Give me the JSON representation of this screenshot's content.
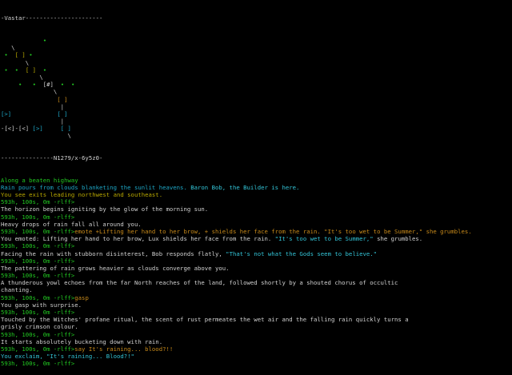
{
  "header": {
    "title_line": "-Vastar----------------------"
  },
  "colors": {
    "prompt": "#22c822",
    "map_node": "#22c822",
    "map_room": "#b9a800",
    "exit": "#1ea8c8",
    "speech": "#33c5d8",
    "emote": "#c88a1a"
  },
  "map": {
    "rows": [
      [
        {
          "t": "            ",
          "c": "c-white"
        },
        {
          "t": "•",
          "c": "c-green"
        }
      ],
      [
        {
          "t": "   \\",
          "c": "c-white"
        }
      ],
      [
        {
          "t": " ",
          "c": "c-white"
        },
        {
          "t": "•",
          "c": "c-green"
        },
        {
          "t": "  ",
          "c": "c-white"
        },
        {
          "t": "[ ]",
          "c": "c-olive"
        },
        {
          "t": " ",
          "c": "c-white"
        },
        {
          "t": "•",
          "c": "c-green"
        }
      ],
      [
        {
          "t": "       \\",
          "c": "c-white"
        }
      ],
      [
        {
          "t": " ",
          "c": "c-white"
        },
        {
          "t": "•",
          "c": "c-green"
        },
        {
          "t": "  ",
          "c": "c-white"
        },
        {
          "t": "•",
          "c": "c-green"
        },
        {
          "t": "  ",
          "c": "c-white"
        },
        {
          "t": "[ ]",
          "c": "c-olive"
        },
        {
          "t": "  ",
          "c": "c-white"
        },
        {
          "t": "•",
          "c": "c-green"
        }
      ],
      [
        {
          "t": "           \\",
          "c": "c-white"
        }
      ],
      [
        {
          "t": "     ",
          "c": "c-white"
        },
        {
          "t": "•",
          "c": "c-green"
        },
        {
          "t": "   ",
          "c": "c-white"
        },
        {
          "t": "•",
          "c": "c-green"
        },
        {
          "t": "  ",
          "c": "c-white"
        },
        {
          "t": "[#]",
          "c": "c-white"
        },
        {
          "t": "  ",
          "c": "c-white"
        },
        {
          "t": "•",
          "c": "c-green"
        },
        {
          "t": "  ",
          "c": "c-white"
        },
        {
          "t": "•",
          "c": "c-green"
        }
      ],
      [
        {
          "t": "               \\",
          "c": "c-white"
        }
      ],
      [
        {
          "t": "                ",
          "c": "c-white"
        },
        {
          "t": "[ ]",
          "c": "c-orange"
        }
      ],
      [
        {
          "t": "                 |",
          "c": "c-white"
        }
      ],
      [
        {
          "t": "[>]",
          "c": "c-cyan"
        },
        {
          "t": "             ",
          "c": "c-white"
        },
        {
          "t": "[ ]",
          "c": "c-cyan"
        }
      ],
      [
        {
          "t": "                 |",
          "c": "c-white"
        }
      ],
      [
        {
          "t": "-[<]-[<] ",
          "c": "c-white"
        },
        {
          "t": "[>]",
          "c": "c-cyan"
        },
        {
          "t": "     ",
          "c": "c-white"
        },
        {
          "t": "[ ]",
          "c": "c-cyan"
        }
      ],
      [
        {
          "t": "                   \\",
          "c": "c-white"
        }
      ]
    ],
    "footer_line": "---------------N1279/x-6y5z0-"
  },
  "log": [
    [
      {
        "t": "Along a beaten highway",
        "c": "c-green"
      }
    ],
    [
      {
        "t": "Rain pours from clouds blanketing the sunlit heavens. ",
        "c": "c-cyan"
      },
      {
        "t": "Baron Bob, the Builder is here.",
        "c": "c-cyan2"
      }
    ],
    [
      {
        "t": "You see exits leading northwest and southeast.",
        "c": "c-olive"
      }
    ],
    [
      {
        "t": "593h, 100s, 0m -rlff>",
        "c": "c-green"
      }
    ],
    [
      {
        "t": "The horizon begins igniting by the glow of the morning sun.",
        "c": "c-white"
      }
    ],
    [
      {
        "t": "593h, 100s, 0m -rlff>",
        "c": "c-green"
      }
    ],
    [
      {
        "t": "Heavy drops of rain fall all around you.",
        "c": "c-white"
      }
    ],
    [
      {
        "t": "593h, 100s, 0m -rlff>",
        "c": "c-green"
      },
      {
        "t": "emote +Lifting her hand to her brow, + shields her face from the rain. \"It's too wet to be Summer,\" she grumbles.",
        "c": "c-orange"
      }
    ],
    [
      {
        "t": "You emoted: Lifting her hand to her brow, Lux shields her face from the rain. ",
        "c": "c-white"
      },
      {
        "t": "\"It's too wet to be Summer,\"",
        "c": "c-cyan2"
      },
      {
        "t": " she grumbles.",
        "c": "c-white"
      }
    ],
    [
      {
        "t": "593h, 100s, 0m -rlff>",
        "c": "c-green"
      }
    ],
    [
      {
        "t": "Facing the rain with stubborn disinterest, Bob responds flatly, ",
        "c": "c-white"
      },
      {
        "t": "\"That's not what the Gods seem to believe.\"",
        "c": "c-cyan2"
      }
    ],
    [
      {
        "t": "593h, 100s, 0m -rlff>",
        "c": "c-green"
      }
    ],
    [
      {
        "t": "The pattering of rain grows heavier as clouds converge above you.",
        "c": "c-white"
      }
    ],
    [
      {
        "t": "593h, 100s, 0m -rlff>",
        "c": "c-green"
      }
    ],
    [
      {
        "t": "A thunderous yowl echoes from the far North reaches of the land, followed shortly by a shouted chorus of occultic",
        "c": "c-white"
      }
    ],
    [
      {
        "t": "chanting.",
        "c": "c-white"
      }
    ],
    [
      {
        "t": "593h, 100s, 0m -rlff>",
        "c": "c-green"
      },
      {
        "t": "gasp",
        "c": "c-orange"
      }
    ],
    [
      {
        "t": "You gasp with surprise.",
        "c": "c-white"
      }
    ],
    [
      {
        "t": "593h, 100s, 0m -rlff>",
        "c": "c-green"
      }
    ],
    [
      {
        "t": "Touched by the Witches' profane ritual, the scent of rust permeates the wet air and the falling rain quickly turns a",
        "c": "c-white"
      }
    ],
    [
      {
        "t": "grisly crimson colour.",
        "c": "c-white"
      }
    ],
    [
      {
        "t": "593h, 100s, 0m -rlff>",
        "c": "c-green"
      }
    ],
    [
      {
        "t": "It starts absolutely bucketing down with rain.",
        "c": "c-white"
      }
    ],
    [
      {
        "t": "593h, 100s, 0m -rlff>",
        "c": "c-green"
      },
      {
        "t": "say It's raining... blood?!!",
        "c": "c-orange"
      }
    ],
    [
      {
        "t": "You exclaim, ",
        "c": "c-cyan2"
      },
      {
        "t": "\"It's raining... Blood?!\"",
        "c": "c-cyan2"
      }
    ],
    [
      {
        "t": "593h, 100s, 0m -rlff>",
        "c": "c-green"
      }
    ]
  ]
}
